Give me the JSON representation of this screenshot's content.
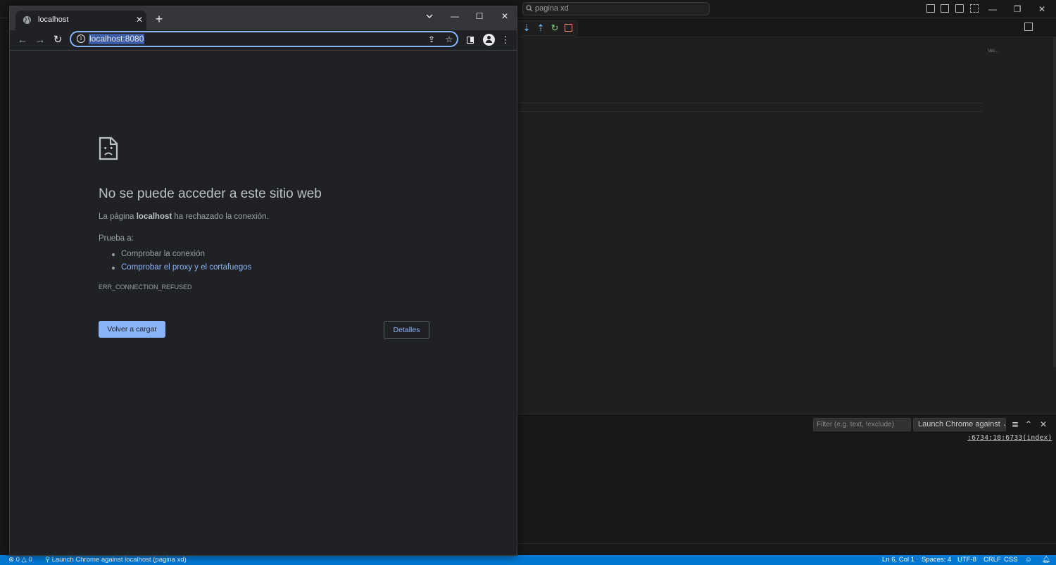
{
  "vscode": {
    "search_text": "pagina xd",
    "minimap_text": "Wo...",
    "panel": {
      "filter_placeholder": "Filter (e.g. text, !exclude)",
      "launch_select": "Launch Chrome against",
      "console_link": ":6734:18:6733(index)"
    },
    "statusbar": {
      "errors": "0",
      "warnings": "0",
      "debug_target": "Launch Chrome against localhost (pagina xd)",
      "position": "Ln 6, Col 1",
      "spaces": "Spaces: 4",
      "encoding": "UTF-8",
      "eol": "CRLF",
      "language": "CSS"
    },
    "colors": {
      "statusbar": "#0078d4",
      "editor_bg": "#1f1f1f",
      "panel_bg": "#181818"
    }
  },
  "chrome": {
    "tab_title": "localhost",
    "url": "localhost:8080",
    "icons": [
      "globe-icon",
      "close-icon",
      "plus-icon",
      "chevron-down-icon",
      "back-arrow-icon",
      "forward-arrow-icon",
      "reload-icon",
      "info-icon",
      "share-icon",
      "star-icon",
      "side-panel-icon",
      "profile-icon",
      "kebab-menu-icon"
    ],
    "colors": {
      "accent": "#8ab4f8",
      "page_bg": "#202124"
    }
  },
  "error": {
    "title": "No se puede acceder a este sitio web",
    "desc_pre": "La página ",
    "desc_host": "localhost",
    "desc_post": " ha rechazado la conexión.",
    "try_label": "Prueba a:",
    "suggestions": [
      "Comprobar la conexión",
      "Comprobar el proxy y el cortafuegos"
    ],
    "code": "ERR_CONNECTION_REFUSED",
    "reload_label": "Volver a cargar",
    "details_label": "Detalles"
  }
}
